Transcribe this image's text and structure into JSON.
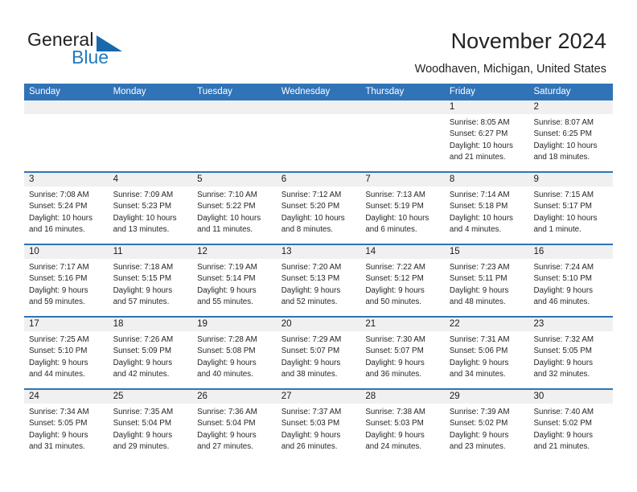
{
  "brand": {
    "name_top": "General",
    "name_bottom": "Blue",
    "triangle_icon": "triangle-icon",
    "color_dark": "#231f20",
    "color_blue": "#1f7bc1"
  },
  "header": {
    "title": "November 2024",
    "subtitle": "Woodhaven, Michigan, United States"
  },
  "theme": {
    "header_blue": "#3073b7",
    "day_strip_gray": "#f0f0f0",
    "text": "#262626"
  },
  "calendar": {
    "weekday_headers": [
      "Sunday",
      "Monday",
      "Tuesday",
      "Wednesday",
      "Thursday",
      "Friday",
      "Saturday"
    ],
    "weeks": [
      [
        {
          "day": "",
          "lines": []
        },
        {
          "day": "",
          "lines": []
        },
        {
          "day": "",
          "lines": []
        },
        {
          "day": "",
          "lines": []
        },
        {
          "day": "",
          "lines": []
        },
        {
          "day": "1",
          "lines": [
            "Sunrise: 8:05 AM",
            "Sunset: 6:27 PM",
            "Daylight: 10 hours",
            "and 21 minutes."
          ]
        },
        {
          "day": "2",
          "lines": [
            "Sunrise: 8:07 AM",
            "Sunset: 6:25 PM",
            "Daylight: 10 hours",
            "and 18 minutes."
          ]
        }
      ],
      [
        {
          "day": "3",
          "lines": [
            "Sunrise: 7:08 AM",
            "Sunset: 5:24 PM",
            "Daylight: 10 hours",
            "and 16 minutes."
          ]
        },
        {
          "day": "4",
          "lines": [
            "Sunrise: 7:09 AM",
            "Sunset: 5:23 PM",
            "Daylight: 10 hours",
            "and 13 minutes."
          ]
        },
        {
          "day": "5",
          "lines": [
            "Sunrise: 7:10 AM",
            "Sunset: 5:22 PM",
            "Daylight: 10 hours",
            "and 11 minutes."
          ]
        },
        {
          "day": "6",
          "lines": [
            "Sunrise: 7:12 AM",
            "Sunset: 5:20 PM",
            "Daylight: 10 hours",
            "and 8 minutes."
          ]
        },
        {
          "day": "7",
          "lines": [
            "Sunrise: 7:13 AM",
            "Sunset: 5:19 PM",
            "Daylight: 10 hours",
            "and 6 minutes."
          ]
        },
        {
          "day": "8",
          "lines": [
            "Sunrise: 7:14 AM",
            "Sunset: 5:18 PM",
            "Daylight: 10 hours",
            "and 4 minutes."
          ]
        },
        {
          "day": "9",
          "lines": [
            "Sunrise: 7:15 AM",
            "Sunset: 5:17 PM",
            "Daylight: 10 hours",
            "and 1 minute."
          ]
        }
      ],
      [
        {
          "day": "10",
          "lines": [
            "Sunrise: 7:17 AM",
            "Sunset: 5:16 PM",
            "Daylight: 9 hours",
            "and 59 minutes."
          ]
        },
        {
          "day": "11",
          "lines": [
            "Sunrise: 7:18 AM",
            "Sunset: 5:15 PM",
            "Daylight: 9 hours",
            "and 57 minutes."
          ]
        },
        {
          "day": "12",
          "lines": [
            "Sunrise: 7:19 AM",
            "Sunset: 5:14 PM",
            "Daylight: 9 hours",
            "and 55 minutes."
          ]
        },
        {
          "day": "13",
          "lines": [
            "Sunrise: 7:20 AM",
            "Sunset: 5:13 PM",
            "Daylight: 9 hours",
            "and 52 minutes."
          ]
        },
        {
          "day": "14",
          "lines": [
            "Sunrise: 7:22 AM",
            "Sunset: 5:12 PM",
            "Daylight: 9 hours",
            "and 50 minutes."
          ]
        },
        {
          "day": "15",
          "lines": [
            "Sunrise: 7:23 AM",
            "Sunset: 5:11 PM",
            "Daylight: 9 hours",
            "and 48 minutes."
          ]
        },
        {
          "day": "16",
          "lines": [
            "Sunrise: 7:24 AM",
            "Sunset: 5:10 PM",
            "Daylight: 9 hours",
            "and 46 minutes."
          ]
        }
      ],
      [
        {
          "day": "17",
          "lines": [
            "Sunrise: 7:25 AM",
            "Sunset: 5:10 PM",
            "Daylight: 9 hours",
            "and 44 minutes."
          ]
        },
        {
          "day": "18",
          "lines": [
            "Sunrise: 7:26 AM",
            "Sunset: 5:09 PM",
            "Daylight: 9 hours",
            "and 42 minutes."
          ]
        },
        {
          "day": "19",
          "lines": [
            "Sunrise: 7:28 AM",
            "Sunset: 5:08 PM",
            "Daylight: 9 hours",
            "and 40 minutes."
          ]
        },
        {
          "day": "20",
          "lines": [
            "Sunrise: 7:29 AM",
            "Sunset: 5:07 PM",
            "Daylight: 9 hours",
            "and 38 minutes."
          ]
        },
        {
          "day": "21",
          "lines": [
            "Sunrise: 7:30 AM",
            "Sunset: 5:07 PM",
            "Daylight: 9 hours",
            "and 36 minutes."
          ]
        },
        {
          "day": "22",
          "lines": [
            "Sunrise: 7:31 AM",
            "Sunset: 5:06 PM",
            "Daylight: 9 hours",
            "and 34 minutes."
          ]
        },
        {
          "day": "23",
          "lines": [
            "Sunrise: 7:32 AM",
            "Sunset: 5:05 PM",
            "Daylight: 9 hours",
            "and 32 minutes."
          ]
        }
      ],
      [
        {
          "day": "24",
          "lines": [
            "Sunrise: 7:34 AM",
            "Sunset: 5:05 PM",
            "Daylight: 9 hours",
            "and 31 minutes."
          ]
        },
        {
          "day": "25",
          "lines": [
            "Sunrise: 7:35 AM",
            "Sunset: 5:04 PM",
            "Daylight: 9 hours",
            "and 29 minutes."
          ]
        },
        {
          "day": "26",
          "lines": [
            "Sunrise: 7:36 AM",
            "Sunset: 5:04 PM",
            "Daylight: 9 hours",
            "and 27 minutes."
          ]
        },
        {
          "day": "27",
          "lines": [
            "Sunrise: 7:37 AM",
            "Sunset: 5:03 PM",
            "Daylight: 9 hours",
            "and 26 minutes."
          ]
        },
        {
          "day": "28",
          "lines": [
            "Sunrise: 7:38 AM",
            "Sunset: 5:03 PM",
            "Daylight: 9 hours",
            "and 24 minutes."
          ]
        },
        {
          "day": "29",
          "lines": [
            "Sunrise: 7:39 AM",
            "Sunset: 5:02 PM",
            "Daylight: 9 hours",
            "and 23 minutes."
          ]
        },
        {
          "day": "30",
          "lines": [
            "Sunrise: 7:40 AM",
            "Sunset: 5:02 PM",
            "Daylight: 9 hours",
            "and 21 minutes."
          ]
        }
      ]
    ]
  }
}
